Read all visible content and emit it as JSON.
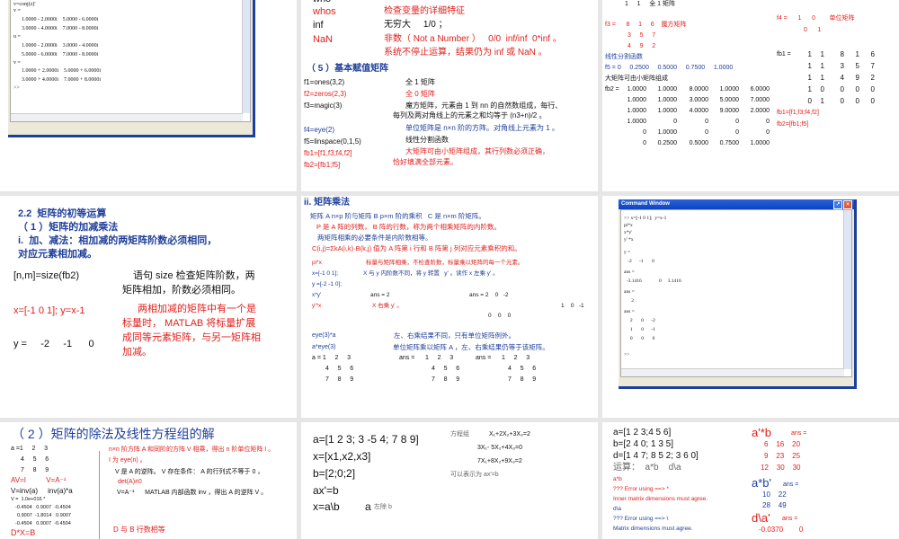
{
  "s1": {
    "lines": [
      "v=conj(z)'",
      "v =",
      "1.0000 - 2.0000i    5.0000 - 6.0000i",
      "3.0000 - 4.0000i    7.0000 - 8.0000i",
      "u =",
      "1.0000 - 2.0000i    3.0000 - 4.0000i",
      "5.0000 - 6.0000i    7.0000 - 8.0000i",
      "v =",
      "1.0000 + 2.0000i    5.0000 + 6.0000i",
      "3.0000 + 4.0000i    7.0000 + 8.0000i",
      ">>"
    ]
  },
  "s2": {
    "who": "who",
    "whos": "whos",
    "whos_d": "检查变量的详细特征",
    "inf": "inf",
    "inf_d": "无穷大     1/0 ；",
    "nan": "NaN",
    "nan_d": "非数（ Not a Number ）   0/0  inf/inf  0*inf 。",
    "nan_d2": "系统不停止运算，结果仍为 inf 或 NaN 。",
    "heading": "（ 5 ）基本赋值矩阵",
    "f1": "f1=ones(3,2)",
    "f1_d": "全 1 矩阵",
    "f2": "f2=zeros(2,3)",
    "f2_d": "全 0 矩阵",
    "f3": "f3=magic(3)",
    "f3_d": "魔方矩阵，元素由 1 到 nn 的自然数组成，每行、",
    "f3_d2": "每列及两对角线上的元素之和均等于 (n3+n)/2 。",
    "f4": "f4=eye(2)",
    "f4_d": "单位矩阵是 n×n 阶的方阵。对角线上元素为 1 。",
    "f5": "f5=linspace(0,1,5)",
    "f5_d": "线性分割函数",
    "fb1": "fb1=[f1,f3;f4,f2]",
    "fb1_d": "大矩阵可由小矩阵组成，其行列数必须正确，",
    "fb2": "fb2=[fb1;f5]",
    "fb2_d": "恰好填满全部元素。"
  },
  "s3": {
    "top": "1     1     全 1 矩阵",
    "f3": "f3 =      8     1     6    魔方矩阵",
    "f3r2": "3     5     7",
    "f3r3": "4     9     2",
    "lin": "线性分割函数",
    "f5": "f5 = 0     0.2500     0.5000     0.7500     1.0000",
    "big": "大矩阵可由小矩阵组成",
    "fb2_label": "fb2 =",
    "fb2": [
      [
        "1.0000",
        "1.0000",
        "8.0000",
        "1.0000",
        "6.0000"
      ],
      [
        "1.0000",
        "1.0000",
        "3.0000",
        "5.0000",
        "7.0000"
      ],
      [
        "1.0000",
        "1.0000",
        "4.0000",
        "9.0000",
        "2.0000"
      ],
      [
        "1.0000",
        "0",
        "0",
        "0",
        "0"
      ],
      [
        "0",
        "1.0000",
        "0",
        "0",
        "0"
      ],
      [
        "0",
        "0.2500",
        "0.5000",
        "0.7500",
        "1.0000"
      ]
    ],
    "f4": "f4 =      1      0        单位矩阵",
    "f4r2": "0      1",
    "fb1_label": "fb1 =",
    "fb1": [
      [
        "1",
        "1",
        "8",
        "1",
        "6"
      ],
      [
        "1",
        "1",
        "3",
        "5",
        "7"
      ],
      [
        "1",
        "1",
        "4",
        "9",
        "2"
      ],
      [
        "1",
        "0",
        "0",
        "0",
        "0"
      ],
      [
        "0",
        "1",
        "0",
        "0",
        "0"
      ]
    ],
    "fb1_def": "fb1=[f1,f3;f4,f2]",
    "fb2_def": "fb2=[fb1;f5]"
  },
  "s4": {
    "h1": "2.2  矩阵的初等运算",
    "h2": "（ 1 ）矩阵的加减乘法",
    "h3": "i.  加、减法：相加减的两矩阵阶数必须相同，",
    "h4": "对应元素相加减。",
    "size": "[n,m]=size(fb2)",
    "size_d": "语句 size 检查矩阵阶数，两",
    "size_d2": "矩阵相加，阶数必须相同。",
    "xy": "x=[-1 0 1]; y=x-1",
    "d1": "两相加减的矩阵中有一个是",
    "d2": "标量时， MATLAB 将标量扩展",
    "d3": "成同等元素矩阵，与另一矩阵相",
    "d4": "加减。",
    "y": "y =     -2     -1      0"
  },
  "s5": {
    "h": "ii. 矩阵乘法",
    "l1": "矩阵 A n×p 阶与矩阵 B p×m 阶的乘积   C 是 n×m 阶矩阵。",
    "l2": "P 是 A 阵的列数， B 阵的行数，称为两个相乘矩阵的内阶数。",
    "l3": "两矩阵相乘的必要条件是内阶数相等。",
    "l4": "C(i,j)=ΣkA(i,k)·B(k,j) 值为 A 阵第 i 行和 B 阵第 j 列对应元素乘积的和。",
    "pix": "pi*x",
    "pix_d": "标量与矩阵相乘，不检查阶数，标量乘以矩阵的每一个元素。",
    "x": "x=[-1 0 1];",
    "x_d": "X 与 y 内阶数不同，将 y 转置   y' 。读作 x 左乘 y' 。",
    "y": "y =[-2 -1 0];",
    "xy": "x*y'",
    "ans1": "ans = 2",
    "ans2": "ans = 2    0   -2",
    "yx": "y'*x",
    "yx_d": "X 右乘 y' 。",
    "r1": "1    0   -1",
    "r3": "0    0    0",
    "e1": "eye(3)*a",
    "e1_d": "左、右乘结果不同，只有单位矩阵例外。",
    "e2": "a*eye(3)",
    "e2_d": "单位矩阵乘以矩阵 A ，左、右乘结果仍等于该矩阵。",
    "a1": "a = 1     2     3",
    "a2": "4     5     6",
    "a3": "7     8     9",
    "ans_a": "ans =      1     2     3",
    "ans_b": "ans =      1     2     3"
  },
  "s6": {
    "title": "Command Window",
    "lines": [
      ">> x=[-1 0 1];  y=x-1",
      "pi*x",
      "x*y'",
      "y' *x",
      "y =",
      "   -2      -1       0",
      "ans =",
      "  -3.1416              0     3.1416",
      "ans =",
      "      2",
      "ans =",
      "     2       0      -2",
      "     1       0      -1",
      "     0       0       0",
      ">>"
    ]
  },
  "s7": {
    "title": "（ 2 ）矩阵的除法及线性方程组的解",
    "a1": "a =1     2     3",
    "a2": "4     5     6",
    "a3": "7     8     9",
    "av": "AV=I          V=A⁻¹",
    "inv": "V=inv(a)     inv(a)*a",
    "v": "V =  1.0e+016 *",
    "v1": "-0.4504   0.9007  -0.4504",
    "v2": "0.9007  -1.8014   0.9007",
    "v3": "-0.4504   0.9007  -0.4504",
    "dxb": "D*X=B",
    "r1": "n×n 阶方阵 A 和同阶的方阵 V 相乘，得出 n 阶单位矩阵 I 。",
    "r2": "I 为 eye(n) 。",
    "r3": "V 是 A 的逆阵。 V 存在条件： A 的行列式不等于 0 ，",
    "r4": "det(A)≠0",
    "r5": "V=A⁻¹      MATLAB 内部函数 inv ，得出 A 的逆阵 V 。",
    "r6": "D 与 B 行数相等"
  },
  "s8": {
    "a": "a=[1 2 3; 3 -5 4; 7 8 9]",
    "x": "x=[x1,x2,x3]",
    "b": "b=[2;0;2]",
    "axb": "ax'=b",
    "xab": "x=a\\b",
    "a_lbl": "a",
    "ldiv": "左除 b",
    "eq": "方程组",
    "e1": "X₁+2X₂+3X₃=2",
    "e2": "3X₁- 5X₂+4X₃=0",
    "e3": "7X₁+8X₂+9X₃=2",
    "expr": "可以表示为 ax'=b"
  },
  "s9": {
    "a": "a=[1 2 3;4 5 6]",
    "b": "b=[2 4 0; 1 3 5]",
    "d": "d=[1 4 7; 8 5 2; 3 6 0]",
    "op": "运算：  a*b    d\\a",
    "ab": "a*b",
    "err1": "??? Error using ==> *",
    "err1b": "Inner matrix dimensions must agree.",
    "da": "d\\a",
    "err2": "??? Error using ==> \\",
    "err2b": "Matrix dimensions must agree.",
    "atb": "a'*b",
    "ans": "ans =",
    "atb1": "6    16    20",
    "atb2": "9    23    25",
    "atb3": "12    30    30",
    "abt": "a*b'",
    "abt1": "10    22",
    "abt2": "28    49",
    "dat": "d\\a'",
    "dat1": "-0.0370        0"
  }
}
